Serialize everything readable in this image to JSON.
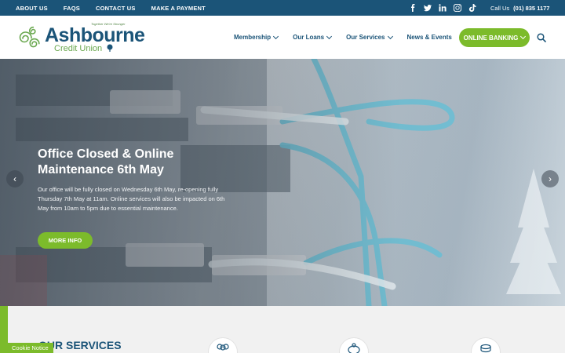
{
  "topbar": {
    "links": [
      "ABOUT US",
      "FAQS",
      "CONTACT US",
      "MAKE A PAYMENT"
    ],
    "social_icons": [
      "facebook-icon",
      "twitter-icon",
      "linkedin-icon",
      "instagram-icon",
      "tiktok-icon"
    ],
    "call_label": "Call Us",
    "phone": "(01) 835 1177"
  },
  "logo": {
    "tagline": "Together We're Stronger",
    "name": "Ashbourne",
    "sub": "Credit Union"
  },
  "nav": {
    "items": [
      "Membership",
      "Our Loans",
      "Our Services",
      "News & Events"
    ],
    "banking": "ONLINE BANKING"
  },
  "hero": {
    "title": "Office Closed & Online Maintenance 6th May",
    "body": "Our office will be fully closed on Wednesday 6th May, re-opening fully Thursday 7th May at 11am. Online services will also be impacted on 6th May from 10am to 5pm due to essential maintenance.",
    "cta": "MORE INFO",
    "prev": "‹",
    "next": "›"
  },
  "services": {
    "heading": "OUR SERVICES",
    "icons": [
      "members-icon",
      "piggy-bank-icon",
      "coins-icon"
    ]
  },
  "cookie": "Cookie Notice",
  "colors": {
    "brand_blue": "#1b5478",
    "brand_green": "#7cbb2b",
    "services_bg": "#f1f1f1"
  }
}
